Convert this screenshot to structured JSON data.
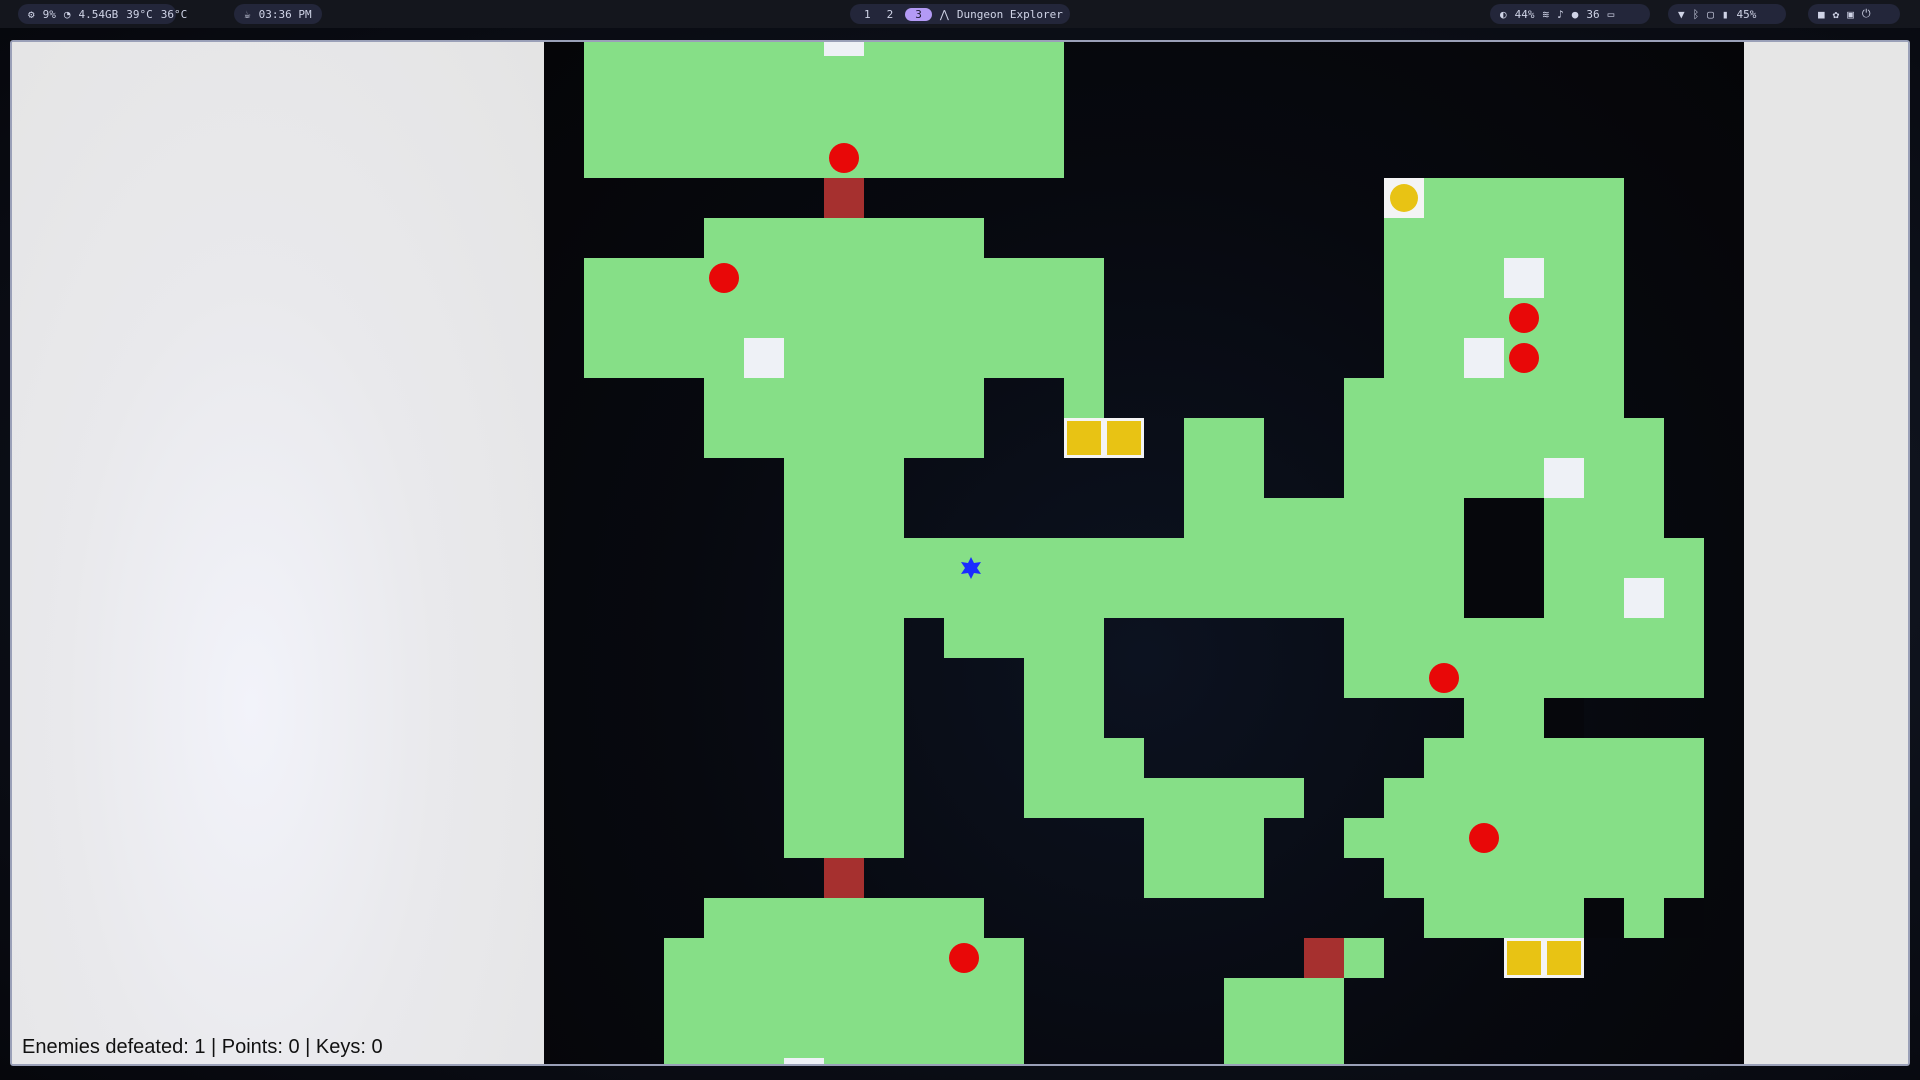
{
  "topbar": {
    "cpu": "9%",
    "memory": "4.54GB",
    "temp1": "39°C",
    "temp2": "36°C",
    "clock": "03:36 PM",
    "workspaces": [
      "1",
      "2",
      "3"
    ],
    "active_workspace": "3",
    "window_title": "Dungeon Explorer",
    "brightness": "44%",
    "volume": "36",
    "battery": "45%"
  },
  "game": {
    "status_text": "Enemies defeated: 1 | Points: 0 | Keys: 0",
    "enemies_defeated": 1,
    "points": 0,
    "keys": 0
  },
  "colors": {
    "floor": "#86df87",
    "wall": "#000000",
    "door": "#a6302f",
    "enemy": "#e80808",
    "treasure": "#e8c314",
    "player": "#1a2cff"
  }
}
